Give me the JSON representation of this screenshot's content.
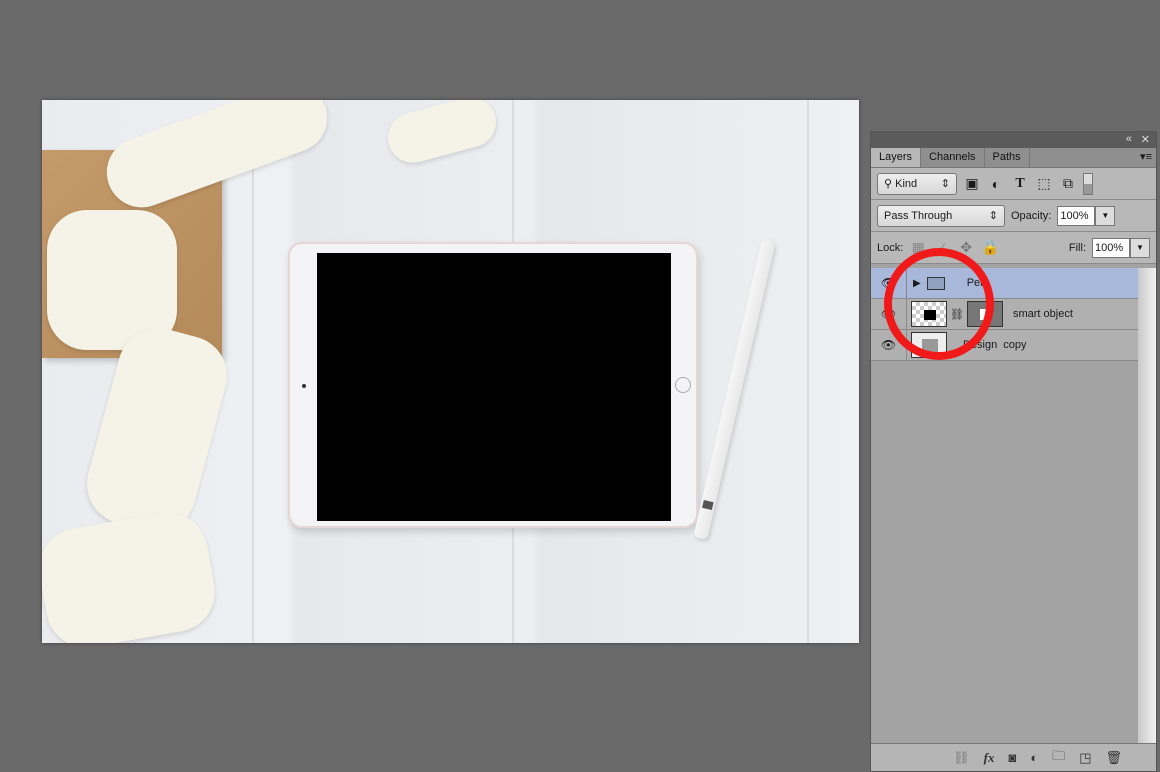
{
  "panel": {
    "tabs": [
      {
        "label": "Layers",
        "active": true
      },
      {
        "label": "Channels"
      },
      {
        "label": "Paths"
      }
    ],
    "filter": {
      "label": "Kind",
      "icons": [
        "image-filter-icon",
        "adjustment-filter-icon",
        "type-filter-icon",
        "shape-filter-icon",
        "smart-object-filter-icon"
      ]
    },
    "blend_mode": "Pass Through",
    "opacity_label": "Opacity:",
    "opacity": "100%",
    "lock_label": "Lock:",
    "fill_label": "Fill:",
    "fill": "100%",
    "layers": [
      {
        "name": "Pen",
        "type": "group",
        "selected": true
      },
      {
        "name": "smart object",
        "type": "smart-object"
      },
      {
        "name": "Design  copy",
        "type": "image"
      }
    ],
    "bottom_icons": [
      "link-icon",
      "fx-icon",
      "mask-icon",
      "adjustment-icon",
      "group-folder-icon",
      "new-layer-icon",
      "trash-icon"
    ],
    "fx_label": "fx"
  },
  "annotation_color": "#f01a1a"
}
